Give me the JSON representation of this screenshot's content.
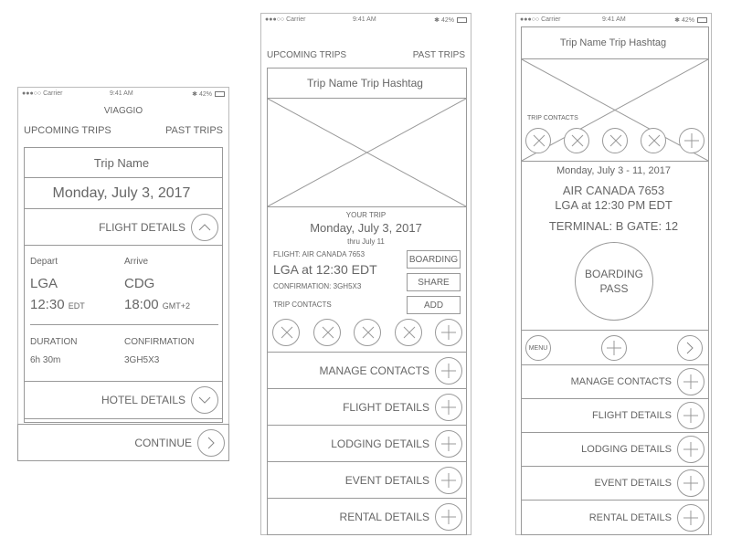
{
  "status": {
    "carrier": "●●●○○ Carrier",
    "time": "9:41 AM",
    "battery": "✱ 42%"
  },
  "screen1": {
    "app_title": "VIAGGIO",
    "tab_upcoming": "UPCOMING TRIPS",
    "tab_past": "PAST TRIPS",
    "trip_name": "Trip Name",
    "date": "Monday, July 3, 2017",
    "flight_details": "FLIGHT DETAILS",
    "depart_label": "Depart",
    "arrive_label": "Arrive",
    "depart_code": "LGA",
    "arrive_code": "CDG",
    "depart_time": "12:30",
    "depart_tz": "EDT",
    "arrive_time": "18:00",
    "arrive_tz": "GMT+2",
    "duration_label": "DURATION",
    "duration": "6h 30m",
    "confirmation_label": "CONFIRMATION",
    "confirmation": "3GH5X3",
    "hotel_details": "HOTEL DETAILS",
    "continue": "CONTINUE"
  },
  "screen2": {
    "tab_upcoming": "UPCOMING TRIPS",
    "tab_past": "PAST TRIPS",
    "header": "Trip Name  Trip Hashtag",
    "your_trip": "YOUR TRIP",
    "date": "Monday, July 3, 2017",
    "thru": "thru July 11",
    "flight": "FLIGHT: AIR CANADA 7653",
    "departure": "LGA at 12:30 EDT",
    "confirmation": "CONFIRMATION: 3GH5X3",
    "trip_contacts": "TRIP CONTACTS",
    "btn_boarding": "BOARDING",
    "btn_share": "SHARE",
    "btn_add": "ADD",
    "rows": [
      "MANAGE CONTACTS",
      "FLIGHT DETAILS",
      "LODGING DETAILS",
      "EVENT DETAILS",
      "RENTAL DETAILS"
    ]
  },
  "screen3": {
    "header": "Trip Name  Trip Hashtag",
    "trip_contacts": "TRIP CONTACTS",
    "dates": "Monday, July 3 - 11, 2017",
    "flight": "AIR CANADA 7653",
    "departure": "LGA at 12:30 PM EDT",
    "gate": "TERMINAL: B GATE: 12",
    "boarding_pass_1": "BOARDING",
    "boarding_pass_2": "PASS",
    "menu": "MENU",
    "rows": [
      "MANAGE CONTACTS",
      "FLIGHT DETAILS",
      "LODGING DETAILS",
      "EVENT DETAILS",
      "RENTAL DETAILS"
    ]
  }
}
